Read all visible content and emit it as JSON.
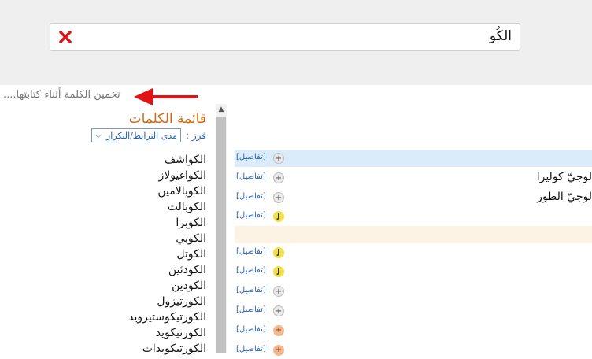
{
  "search": {
    "value": "الكُو"
  },
  "hint": "تخمين الكلمة أثناء كتابتها....",
  "panel": {
    "title": "قائمة الكلمات",
    "sort_label": "فرز :",
    "sort_value": "مدى الترابط/التكرار"
  },
  "words": [
    "الكواشف",
    "الكواغيولاز",
    "الكوبالامين",
    "الكوبالت",
    "الكوبرا",
    "الكوبي",
    "الكوتل",
    "الكودئين",
    "الكودين",
    "الكورتيزول",
    "الكورتيكوستيرويد",
    "الكورتيكويد",
    "الكورتيكويدات"
  ],
  "results": [
    {
      "details": "[تفاصيل]",
      "badge": "+",
      "type": "plus",
      "text": "",
      "style": "sel"
    },
    {
      "details": "[تفاصيل]",
      "badge": "+",
      "type": "plus",
      "text": "لوجيّ كوليرا",
      "style": ""
    },
    {
      "details": "[تفاصيل]",
      "badge": "+",
      "type": "plus",
      "text": "لوجيّ الطور",
      "style": ""
    },
    {
      "details": "[تفاصيل]",
      "badge": "J",
      "type": "j",
      "text": "",
      "style": ""
    },
    {
      "details": "",
      "badge": "",
      "type": "none",
      "text": "",
      "style": "band"
    },
    {
      "details": "[تفاصيل]",
      "badge": "J",
      "type": "j",
      "text": "",
      "style": ""
    },
    {
      "details": "[تفاصيل]",
      "badge": "J",
      "type": "j",
      "text": "",
      "style": ""
    },
    {
      "details": "[تفاصيل]",
      "badge": "+",
      "type": "plus",
      "text": "",
      "style": ""
    },
    {
      "details": "[تفاصيل]",
      "badge": "+",
      "type": "plus",
      "text": "",
      "style": ""
    },
    {
      "details": "[تفاصيل]",
      "badge": "+",
      "type": "orange",
      "text": "",
      "style": ""
    },
    {
      "details": "[تفاصيل]",
      "badge": "+",
      "type": "orange",
      "text": "",
      "style": ""
    }
  ],
  "colors": {
    "accent": "#d36a13",
    "link": "#2a63b8",
    "arrow": "#e01414"
  }
}
